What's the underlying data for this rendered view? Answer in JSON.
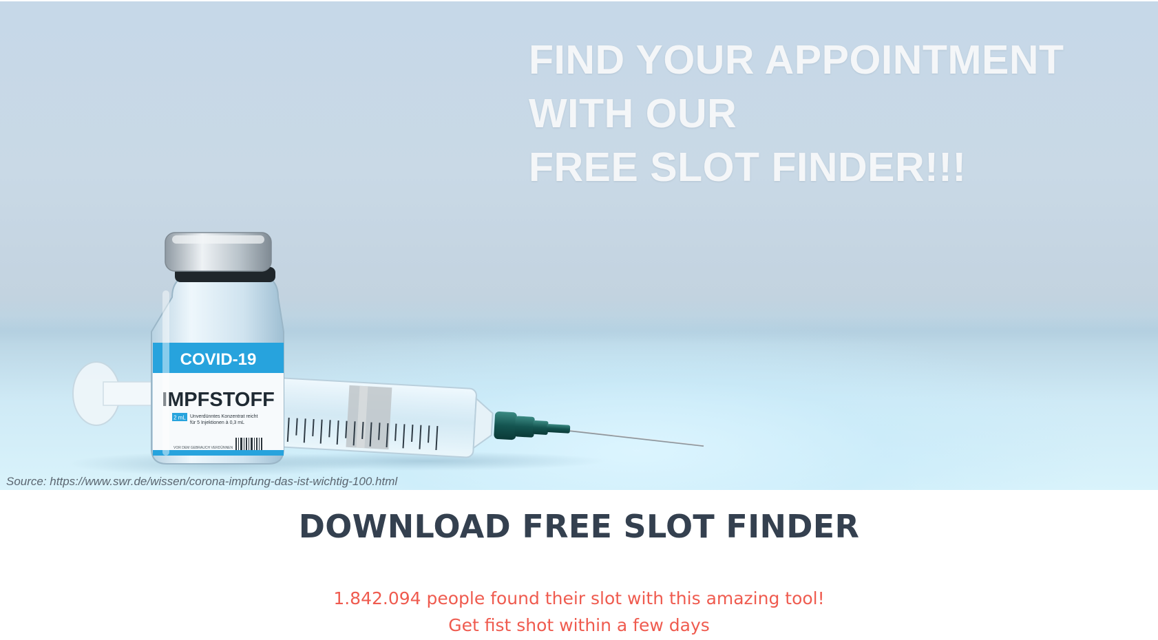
{
  "hero": {
    "headline_lines": [
      "FIND YOUR APPOINTMENT",
      "WITH OUR",
      "FREE SLOT FINDER!!!"
    ],
    "vial_label_top": "COVID-19",
    "vial_label_main": "IMPFSTOFF",
    "vial_label_dose": "2 mL",
    "vial_label_fine_1": "Unverdünntes Konzentrat reicht",
    "vial_label_fine_2": "für 5 Injektionen à 0,3 mL",
    "vial_label_footer": "VOR DEM GEBRAUCH VERDÜNNEN",
    "image_source": "Source: https://www.swr.de/wissen/corona-impfung-das-ist-wichtig-100.html",
    "colors": {
      "vial_band": "#27a3dd",
      "needle_hub": "#1d5f5a"
    }
  },
  "content": {
    "download_heading": "DOWNLOAD FREE SLOT FINDER",
    "stats_text": "1.842.094 people found their slot with this amazing tool!",
    "promise_text": "Get fist shot within a few days",
    "accent_color": "#ef5b4f",
    "heading_color": "#34404f"
  }
}
